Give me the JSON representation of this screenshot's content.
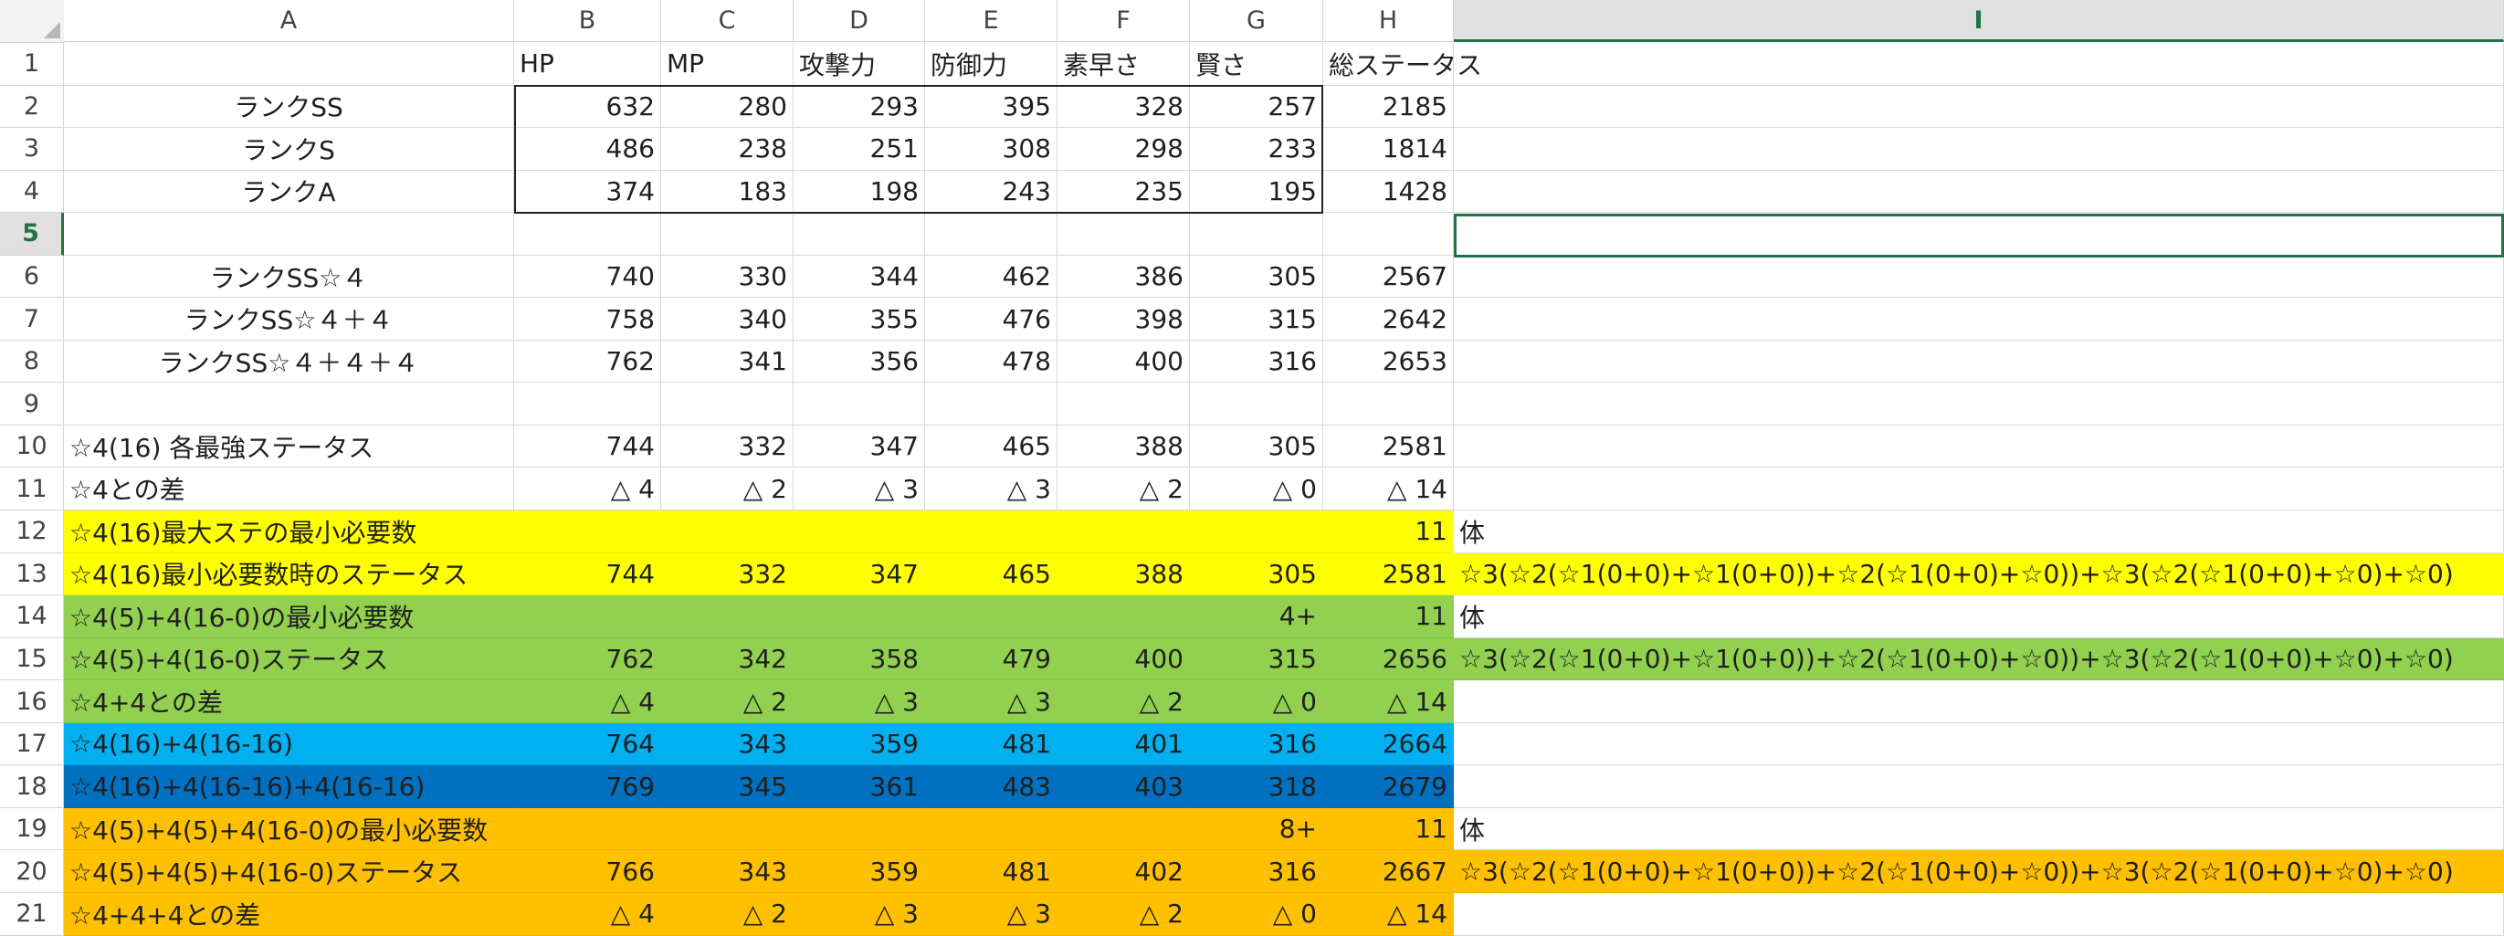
{
  "columns": [
    "A",
    "B",
    "C",
    "D",
    "E",
    "F",
    "G",
    "H",
    "I"
  ],
  "selected_column": "I",
  "selected_row": "5",
  "colors": {
    "yellow": "#ffff00",
    "green": "#92d050",
    "lightblue": "#00b0f0",
    "blue": "#0070c0",
    "orange": "#ffc000",
    "selection": "#217346"
  },
  "rows": [
    {
      "n": "1",
      "A": "",
      "B": "HP",
      "C": "MP",
      "D": "攻撃力",
      "E": "防御力",
      "F": "素早さ",
      "G": "賢さ",
      "H": "総ステータス",
      "I": "",
      "fill": "",
      "hdr": true
    },
    {
      "n": "2",
      "A": "ランクSS",
      "B": "632",
      "C": "280",
      "D": "293",
      "E": "395",
      "F": "328",
      "G": "257",
      "H": "2185",
      "I": "",
      "fill": "",
      "ac": true
    },
    {
      "n": "3",
      "A": "ランクS",
      "B": "486",
      "C": "238",
      "D": "251",
      "E": "308",
      "F": "298",
      "G": "233",
      "H": "1814",
      "I": "",
      "fill": "",
      "ac": true
    },
    {
      "n": "4",
      "A": "ランクA",
      "B": "374",
      "C": "183",
      "D": "198",
      "E": "243",
      "F": "235",
      "G": "195",
      "H": "1428",
      "I": "",
      "fill": "",
      "ac": true
    },
    {
      "n": "5",
      "A": "",
      "B": "",
      "C": "",
      "D": "",
      "E": "",
      "F": "",
      "G": "",
      "H": "",
      "I": "",
      "fill": ""
    },
    {
      "n": "6",
      "A": "ランクSS☆４",
      "B": "740",
      "C": "330",
      "D": "344",
      "E": "462",
      "F": "386",
      "G": "305",
      "H": "2567",
      "I": "",
      "fill": "",
      "ac": true
    },
    {
      "n": "7",
      "A": "ランクSS☆４＋４",
      "B": "758",
      "C": "340",
      "D": "355",
      "E": "476",
      "F": "398",
      "G": "315",
      "H": "2642",
      "I": "",
      "fill": "",
      "ac": true
    },
    {
      "n": "8",
      "A": "ランクSS☆４＋４＋４",
      "B": "762",
      "C": "341",
      "D": "356",
      "E": "478",
      "F": "400",
      "G": "316",
      "H": "2653",
      "I": "",
      "fill": "",
      "ac": true
    },
    {
      "n": "9",
      "A": "",
      "B": "",
      "C": "",
      "D": "",
      "E": "",
      "F": "",
      "G": "",
      "H": "",
      "I": "",
      "fill": ""
    },
    {
      "n": "10",
      "A": "☆4(16) 各最強ステータス",
      "B": "744",
      "C": "332",
      "D": "347",
      "E": "465",
      "F": "388",
      "G": "305",
      "H": "2581",
      "I": "",
      "fill": ""
    },
    {
      "n": "11",
      "A": "☆4との差",
      "B": "△ 4",
      "C": "△ 2",
      "D": "△ 3",
      "E": "△ 3",
      "F": "△ 2",
      "G": "△ 0",
      "H": "△ 14",
      "I": "",
      "fill": ""
    },
    {
      "n": "12",
      "A": "☆4(16)最大ステの最小必要数",
      "B": "",
      "C": "",
      "D": "",
      "E": "",
      "F": "",
      "G": "",
      "H": "11",
      "I": "体",
      "fill": "yellow",
      "ifill": ""
    },
    {
      "n": "13",
      "A": "☆4(16)最小必要数時のステータス",
      "B": "744",
      "C": "332",
      "D": "347",
      "E": "465",
      "F": "388",
      "G": "305",
      "H": "2581",
      "I": "☆3(☆2(☆1(0+0)+☆1(0+0))+☆2(☆1(0+0)+☆0))+☆3(☆2(☆1(0+0)+☆0)+☆0)",
      "fill": "yellow",
      "ifill": "yellow"
    },
    {
      "n": "14",
      "A": "☆4(5)+4(16-0)の最小必要数",
      "B": "",
      "C": "",
      "D": "",
      "E": "",
      "F": "",
      "G": "4+",
      "H": "11",
      "I": "体",
      "fill": "green",
      "ifill": ""
    },
    {
      "n": "15",
      "A": "☆4(5)+4(16-0)ステータス",
      "B": "762",
      "C": "342",
      "D": "358",
      "E": "479",
      "F": "400",
      "G": "315",
      "H": "2656",
      "I": "☆3(☆2(☆1(0+0)+☆1(0+0))+☆2(☆1(0+0)+☆0))+☆3(☆2(☆1(0+0)+☆0)+☆0)",
      "fill": "green",
      "ifill": "green"
    },
    {
      "n": "16",
      "A": "☆4+4との差",
      "B": "△ 4",
      "C": "△ 2",
      "D": "△ 3",
      "E": "△ 3",
      "F": "△ 2",
      "G": "△ 0",
      "H": "△ 14",
      "I": "",
      "fill": "green",
      "ifill": ""
    },
    {
      "n": "17",
      "A": "☆4(16)+4(16-16)",
      "B": "764",
      "C": "343",
      "D": "359",
      "E": "481",
      "F": "401",
      "G": "316",
      "H": "2664",
      "I": "",
      "fill": "lightblue",
      "ifill": ""
    },
    {
      "n": "18",
      "A": "☆4(16)+4(16-16)+4(16-16)",
      "B": "769",
      "C": "345",
      "D": "361",
      "E": "483",
      "F": "403",
      "G": "318",
      "H": "2679",
      "I": "",
      "fill": "blue",
      "ifill": ""
    },
    {
      "n": "19",
      "A": "☆4(5)+4(5)+4(16-0)の最小必要数",
      "B": "",
      "C": "",
      "D": "",
      "E": "",
      "F": "",
      "G": "8+",
      "H": "11",
      "I": "体",
      "fill": "orange",
      "ifill": ""
    },
    {
      "n": "20",
      "A": "☆4(5)+4(5)+4(16-0)ステータス",
      "B": "766",
      "C": "343",
      "D": "359",
      "E": "481",
      "F": "402",
      "G": "316",
      "H": "2667",
      "I": "☆3(☆2(☆1(0+0)+☆1(0+0))+☆2(☆1(0+0)+☆0))+☆3(☆2(☆1(0+0)+☆0)+☆0)",
      "fill": "orange",
      "ifill": "orange"
    },
    {
      "n": "21",
      "A": "☆4+4+4との差",
      "B": "△ 4",
      "C": "△ 2",
      "D": "△ 3",
      "E": "△ 3",
      "F": "△ 2",
      "G": "△ 0",
      "H": "△ 14",
      "I": "",
      "fill": "orange",
      "ifill": ""
    }
  ]
}
